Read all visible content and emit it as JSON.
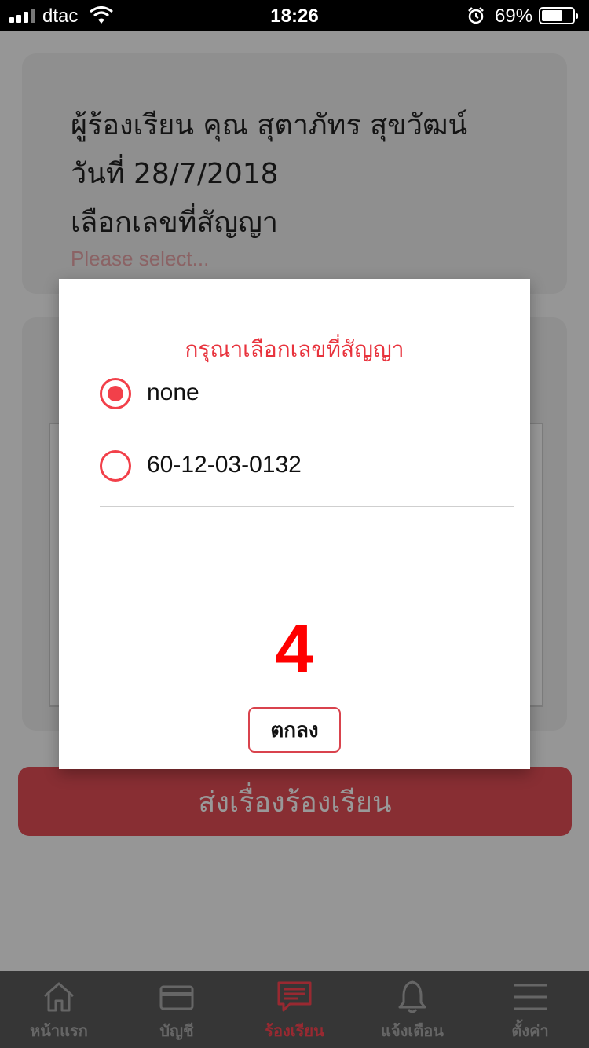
{
  "status_bar": {
    "carrier": "dtac",
    "time": "18:26",
    "battery_pct": "69%",
    "battery_level": 0.69
  },
  "form": {
    "complainant": "ผู้ร้องเรียน คุณ สุตาภัทร สุขวัฒน์",
    "date": "วันที่ 28/7/2018",
    "contract_label": "เลือกเลขที่สัญญา",
    "contract_placeholder": "Please select...",
    "submit_label": "ส่งเรื่องร้องเรียน"
  },
  "dialog": {
    "title": "กรุณาเลือกเลขที่สัญญา",
    "options": [
      {
        "label": "none",
        "selected": true
      },
      {
        "label": "60-12-03-0132",
        "selected": false
      }
    ],
    "annotation_number": "4",
    "ok_label": "ตกลง"
  },
  "tabs": [
    {
      "label": "หน้าแรก",
      "icon": "home-icon",
      "active": false
    },
    {
      "label": "บัญชี",
      "icon": "card-icon",
      "active": false
    },
    {
      "label": "ร้องเรียน",
      "icon": "chat-icon",
      "active": true
    },
    {
      "label": "แจ้งเตือน",
      "icon": "bell-icon",
      "active": false
    },
    {
      "label": "ตั้งค่า",
      "icon": "menu-icon",
      "active": false
    }
  ],
  "colors": {
    "accent": "#f2404a",
    "submit": "#e34d56",
    "tab_active": "#ff4552"
  }
}
